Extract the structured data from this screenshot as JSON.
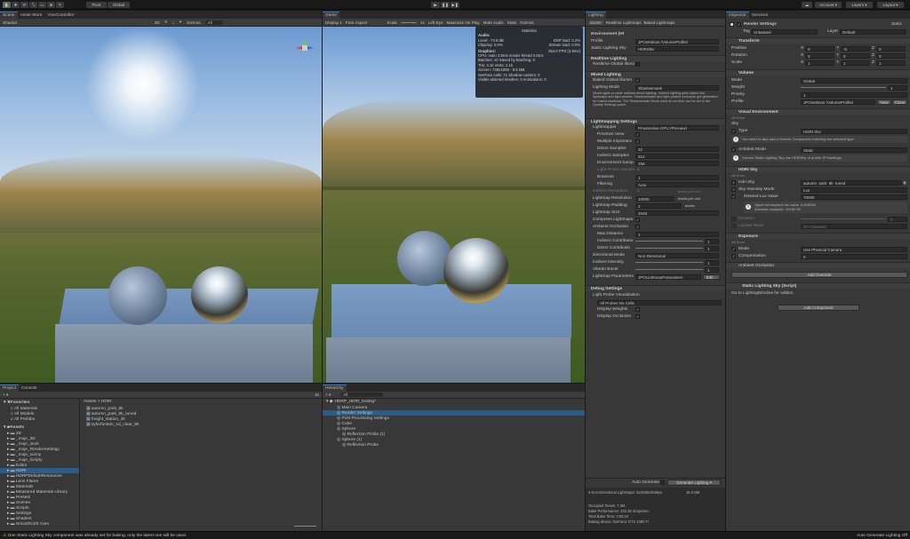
{
  "toolbar": {
    "tools": [
      "hand-tool-icon",
      "move-tool-icon",
      "rotate-tool-icon",
      "scale-tool-icon",
      "rect-tool-icon",
      "transform-tool-icon",
      "custom-tool-icon"
    ],
    "pivot": "Pivot",
    "global": "Global",
    "account": "Account",
    "layers": "Layers",
    "layout": "Layout"
  },
  "scene": {
    "tabs": [
      "Scene",
      "Asset Store",
      "ViveController"
    ],
    "shaded": "Shaded",
    "mode2d": "2D",
    "gizmos": "Gizmos",
    "search": "All"
  },
  "game": {
    "tab": "Game",
    "display": "Display 1",
    "aspect": "Free Aspect",
    "scale_label": "Scale",
    "scale": "1x",
    "eye": "Left Eye",
    "maximize": "Maximize On Play",
    "mute": "Mute Audio",
    "stats": "Stats",
    "gizmos": "Gizmos"
  },
  "stats": {
    "title": "Statistics",
    "audio": "Audio:",
    "level": "Level: -74.8 dB",
    "dsp": "DSP load: 0.2%",
    "clipping": "Clipping: 0.0%",
    "stream": "Stream load: 0.0%",
    "graphics": "Graphics:",
    "fps": "254.0 FPS (3.9ms)",
    "cpu": "CPU: main 3.9ms  render thread 0.8ms",
    "batches": "Batches: 10   Saved by batching: 0",
    "tris": "Tris: 3.1k   Verts: 2.1k",
    "screen": "Screen: 738x1008 - 8.5 MB",
    "setpass": "SetPass calls: 71   Shadow casters: 0",
    "skinned": "Visible skinned meshes: 0   Animations: 0"
  },
  "lighting": {
    "tabs": [
      "Lighting",
      "Scene",
      "Realtime Lightmaps",
      "Baked Lightmaps"
    ],
    "env_header": "Environment (HI",
    "profile_label": "Profile",
    "profile_value": "JPOsettings (VolumeProfile)",
    "static_sky_label": "Static Lighting Sky",
    "static_sky_value": "HDRISky",
    "realtime_header": "Realtime Lighting",
    "realtime_gi": "Realtime Global Illumi",
    "mixed_header": "Mixed Lighting",
    "baked_gi": "Baked Global Illumin",
    "lighting_mode_label": "Lighting Mode",
    "lighting_mode_value": "Shadowmask",
    "mixed_info": "Mixed lights provide realtime direct lighting. Indirect lighting gets baked into lightmaps and light probes. Shadowmasks and light probes occlusion get generated for baked shadows. The Shadowmask Mode used at run time can be set in the Quality Settings panel.",
    "lm_header": "Lightmapping Settings",
    "lightmapper_label": "Lightmapper",
    "lightmapper_value": "Progressive GPU (Preview)",
    "prioritize": "Prioritize View",
    "multiple": "Multiple Importanc",
    "direct_samples_label": "Direct Samples",
    "direct_samples": "32",
    "indirect_samples_label": "Indirect Samples",
    "indirect_samples": "512",
    "env_samples_label": "Environment Samp",
    "env_samples": "256",
    "probe_samples": "Light Probe Sample",
    "probe_samples_value": "4",
    "bounces_label": "Bounces",
    "bounces": "1",
    "filtering_label": "Filtering",
    "filtering": "Auto",
    "indirect_res_label": "Indirect Resolution",
    "indirect_res": "2",
    "texels1": "texels per unit",
    "lm_res_label": "Lightmap Resolution",
    "lm_res": "10000",
    "texels2": "texels per unit",
    "lm_pad_label": "Lightmap Padding",
    "lm_pad": "2",
    "texels3": "texels",
    "lm_size_label": "Lightmap Size",
    "lm_size": "2048",
    "compress": "Compress Lightmaps",
    "ao": "Ambient Occlusion",
    "max_dist_label": "Max Distance",
    "max_dist": "1",
    "ind_contrib_label": "Indirect Contributio",
    "ind_contrib": "1",
    "dir_contrib_label": "Direct Contributio",
    "dir_contrib": "1",
    "dir_mode_label": "Directional Mode",
    "dir_mode": "Non-Directional",
    "ind_intensity_label": "Indirect Intensity",
    "ind_intensity": "1",
    "albedo_label": "Albedo Boost",
    "albedo": "1",
    "lm_params_label": "Lightmap Parameters",
    "lm_params": "JPOLightmapParameters",
    "edit": "Edit...",
    "debug_header": "Debug Settings",
    "probe_vis": "Light Probe Visualization",
    "probe_vis_value": "All Probes No Cells",
    "display_weights": "Display Weights",
    "display_occlusion": "Display Occlusion",
    "auto_generate": "Auto Generate",
    "generate": "Generate Lighting",
    "lm_count": "3 Non-Directional Lightmaps: 3x2048x2048px",
    "lm_mb": "16.0 MB",
    "occupied": "Occupied Texels: 7.3M",
    "perf": "Bake Performance: 332.35 mrays/sec",
    "total_time": "Total Bake Time: 0:00:24",
    "device": "Baking device: GeForce GTX 1080 Ti"
  },
  "inspector": {
    "tabs": [
      "Inspector",
      "Services"
    ],
    "object": "Render Settings",
    "static": "Static",
    "tag_label": "Tag",
    "tag": "Untagged",
    "layer_label": "Layer",
    "layer": "Default",
    "transform": "Transform",
    "position": "Position",
    "rotation": "Rotation",
    "scale": "Scale",
    "pos": [
      "0",
      "-5",
      "0"
    ],
    "rot": [
      "0",
      "0",
      "0"
    ],
    "scl": [
      "1",
      "1",
      "1"
    ],
    "volume": "Volume",
    "mode_label": "Mode",
    "mode": "Global",
    "weight_label": "Weight",
    "weight": "1",
    "priority_label": "Priority",
    "priority": "1",
    "profile_label": "Profile",
    "profile": "JPOsettings (VolumeProfile)",
    "new": "New",
    "clone": "Clone",
    "visual_env": "Visual Environment",
    "all_none": "All  None",
    "sky_label": "Sky",
    "type_label": "Type",
    "type": "HDRI Sky",
    "sky_warn": "You need to also add a Volume Component matching the selected type.",
    "ambient_label": "Ambient Mode",
    "ambient": "Static",
    "ambient_info": "Current Static Lighting Sky use HDRISky of profile JPOsettings",
    "hdri_sky": "HDRI Sky",
    "hdri_label": "Hdri Sky",
    "hdri": "autumn_park_8k_tuned",
    "intensity_mode_label": "Sky Intensity Mode",
    "intensity_mode": "Lux",
    "lux_label": "Desired Lux Value",
    "lux": "70000",
    "lux_info1": "Upper hemisphere lux value: 6.806036",
    "lux_info2": "Absolute multiplier: 10284.28",
    "rotation_label": "Rotation",
    "rotation_value": "0",
    "update_label": "Update Mode",
    "update": "On Changed",
    "exposure": "Exposure",
    "exp_mode_label": "Mode",
    "exp_mode": "Use Physical Camera",
    "comp_label": "Compensation",
    "comp": "0",
    "amb_occ": "Ambient Occlusion",
    "add_override": "Add Override",
    "static_sky_script": "Static Lighting Sky (Script)",
    "goto": "Go to LightingWindow for edition.",
    "add_component": "Add Component"
  },
  "project": {
    "tabs": [
      "Project",
      "Console"
    ],
    "favorites": "Favorites",
    "fav_items": [
      "All Materials",
      "All Models",
      "All Prefabs"
    ],
    "assets": "Assets",
    "folders": [
      "3D",
      "_moje_3D",
      "_moje_okoli",
      "_moje_RenderSettingy",
      "_moje_sceny",
      "_moje_scripty",
      "Editor",
      "HDRI",
      "HDRPDefaultResources",
      "Lens Flares",
      "Materials",
      "Measured Materials Library",
      "Presets",
      "Scenes",
      "Scripts",
      "Settings",
      "Shaders",
      "SmoothCtrlr Cam"
    ],
    "breadcrumb": "Assets > HDRI",
    "files": [
      "autumn_park_8k",
      "autumn_park_8k_tuned",
      "freight_station_4k",
      "syferfontein_1d_clear_8k"
    ],
    "count": "15"
  },
  "hierarchy": {
    "tab": "Hierarchy",
    "search": "All",
    "scene": "HDRP_HDRI_testing*",
    "items": [
      {
        "name": "Main Camera",
        "depth": 1,
        "sel": false
      },
      {
        "name": "Render Settings",
        "depth": 1,
        "sel": true
      },
      {
        "name": "Post Processing Settings",
        "depth": 1,
        "sel": false
      },
      {
        "name": "Cube",
        "depth": 1,
        "sel": false
      },
      {
        "name": "Sphere",
        "depth": 1,
        "sel": false
      },
      {
        "name": "Reflection Probe (1)",
        "depth": 2,
        "sel": false
      },
      {
        "name": "Sphere (1)",
        "depth": 1,
        "sel": false
      },
      {
        "name": "Reflection Probe",
        "depth": 2,
        "sel": false
      }
    ]
  },
  "status": {
    "warning": "One Static Lighting Sky component was already set for baking, only the latest one will be used.",
    "right": "Auto Generate Lighting Off"
  }
}
